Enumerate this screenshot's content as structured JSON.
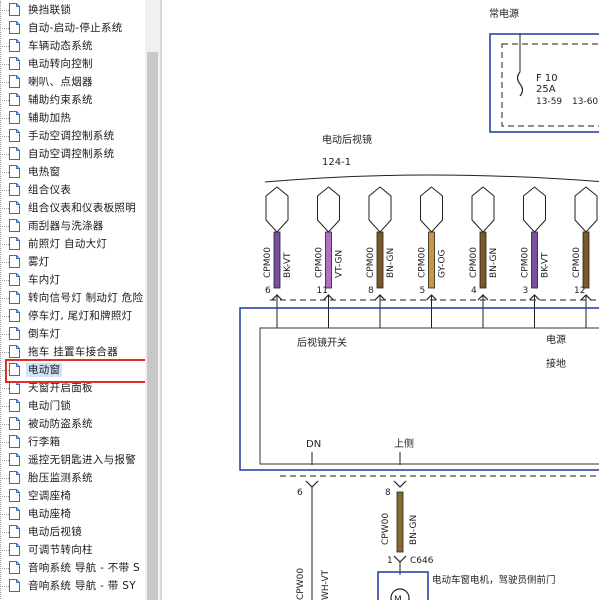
{
  "sidebar": {
    "items": [
      {
        "label": "换挡联锁"
      },
      {
        "label": "自动-启动-停止系统"
      },
      {
        "label": "车辆动态系统"
      },
      {
        "label": "电动转向控制"
      },
      {
        "label": "喇叭、点烟器"
      },
      {
        "label": "辅助约束系统"
      },
      {
        "label": "辅助加热"
      },
      {
        "label": "手动空调控制系统"
      },
      {
        "label": "自动空调控制系统"
      },
      {
        "label": "电热窗"
      },
      {
        "label": "组合仪表"
      },
      {
        "label": "组合仪表和仪表板照明"
      },
      {
        "label": "雨刮器与洗涤器"
      },
      {
        "label": "前照灯 自动大灯"
      },
      {
        "label": "雾灯"
      },
      {
        "label": "车内灯"
      },
      {
        "label": "转向信号灯 制动灯 危险"
      },
      {
        "label": "停车灯, 尾灯和牌照灯"
      },
      {
        "label": "倒车灯"
      },
      {
        "label": "拖车 挂置车接合器"
      },
      {
        "label": "电动窗",
        "selected": true
      },
      {
        "label": "天窗开启面板"
      },
      {
        "label": "电动门锁"
      },
      {
        "label": "被动防盗系统"
      },
      {
        "label": "行李箱"
      },
      {
        "label": "遥控无钥匙进入与报警"
      },
      {
        "label": "胎压监测系统"
      },
      {
        "label": "空调座椅"
      },
      {
        "label": "电动座椅"
      },
      {
        "label": "电动后视镜"
      },
      {
        "label": "可调节转向柱"
      },
      {
        "label": "音响系统 导航 - 不带 S"
      },
      {
        "label": "音响系统 导航 - 带 SY"
      }
    ]
  },
  "diagram": {
    "power_label": "常电源",
    "fuse": {
      "name": "F 10",
      "rating": "25A",
      "ref1": "13-59",
      "ref2": "13-60"
    },
    "mirror_title": "电动后视镜",
    "connector_ref": "124-1",
    "pins": [
      {
        "pin": "6",
        "code": "CPM00",
        "color": "BK-VT",
        "stripe": "#7a4fa0"
      },
      {
        "pin": "11",
        "code": "CPM00",
        "color": "VT-GN",
        "stripe": "#b070c0"
      },
      {
        "pin": "8",
        "code": "CPM00",
        "color": "BN-GN",
        "stripe": "#7a5a2a"
      },
      {
        "pin": "5",
        "code": "CPM00",
        "color": "GY-OG",
        "stripe": "#c89840"
      },
      {
        "pin": "4",
        "code": "CPM00",
        "color": "BN-GN",
        "stripe": "#7a5a2a"
      },
      {
        "pin": "3",
        "code": "CPM00",
        "color": "BK-VT",
        "stripe": "#7a4fa0"
      },
      {
        "pin": "12",
        "code": "CPM00",
        "color": "",
        "stripe": "#7a5a2a"
      }
    ],
    "module": {
      "switch_label": "后视镜开关",
      "power_label": "电源",
      "ground_label": "接地",
      "dn_label": "DN",
      "up_label": "上侧"
    },
    "lower": {
      "pin_left": "6",
      "pin_mid": "8",
      "wire_code": "CPW00",
      "wire_color": "BN-GN",
      "connector_pin": "1",
      "connector_ref": "C646",
      "motor_label": "电动车窗电机，驾驶员侧前门",
      "left_wire_code": "CPW00",
      "left_wire_color": "WH-VT"
    }
  }
}
